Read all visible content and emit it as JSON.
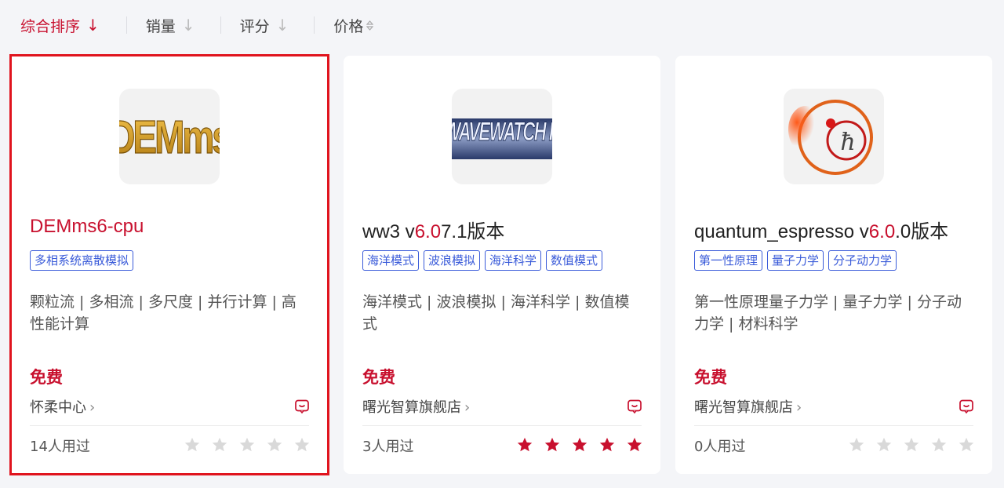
{
  "sort": {
    "items": [
      {
        "label": "综合排序",
        "arrow": "↓"
      },
      {
        "label": "销量",
        "arrow": "↓"
      },
      {
        "label": "评分",
        "arrow": "↓"
      },
      {
        "label": "价格"
      }
    ]
  },
  "cards": [
    {
      "logo_text": "DEMms",
      "title": "DEMms6-cpu",
      "tags": [
        "多相系统离散模拟"
      ],
      "desc": "颗粒流 | 多相流 | 多尺度 | 并行计算 | 高性能计算",
      "price": "免费",
      "store": "怀柔中心",
      "used": "14人用过",
      "rating": 0
    },
    {
      "logo_text": "WAVEWATCH III",
      "title_parts": [
        "ww3 v",
        "6.0",
        "7.1版本"
      ],
      "tags": [
        "海洋模式",
        "波浪模拟",
        "海洋科学",
        "数值模式"
      ],
      "desc": "海洋模式 | 波浪模拟 | 海洋科学 | 数值模式",
      "price": "免费",
      "store": "曙光智算旗舰店",
      "used": "3人用过",
      "rating": 5
    },
    {
      "logo_text": "ħ",
      "title_parts": [
        "quantum_espresso v",
        "6.0",
        ".0版本"
      ],
      "tags": [
        "第一性原理",
        "量子力学",
        "分子动力学"
      ],
      "desc": "第一性原理量子力学 | 量子力学 | 分子动力学 | 材料科学",
      "price": "免费",
      "store": "曙光智算旗舰店",
      "used": "0人用过",
      "rating": 0
    }
  ],
  "colors": {
    "accent": "#c8102e",
    "tag_blue": "#3a5bd9",
    "star_empty": "#d9d9d9",
    "selected_border": "#e0141e"
  },
  "icons": {
    "chat": "chat-bubble-icon",
    "chevron": "chevron-right-icon",
    "star": "star-icon",
    "sort_updown": "sort-updown-icon"
  }
}
